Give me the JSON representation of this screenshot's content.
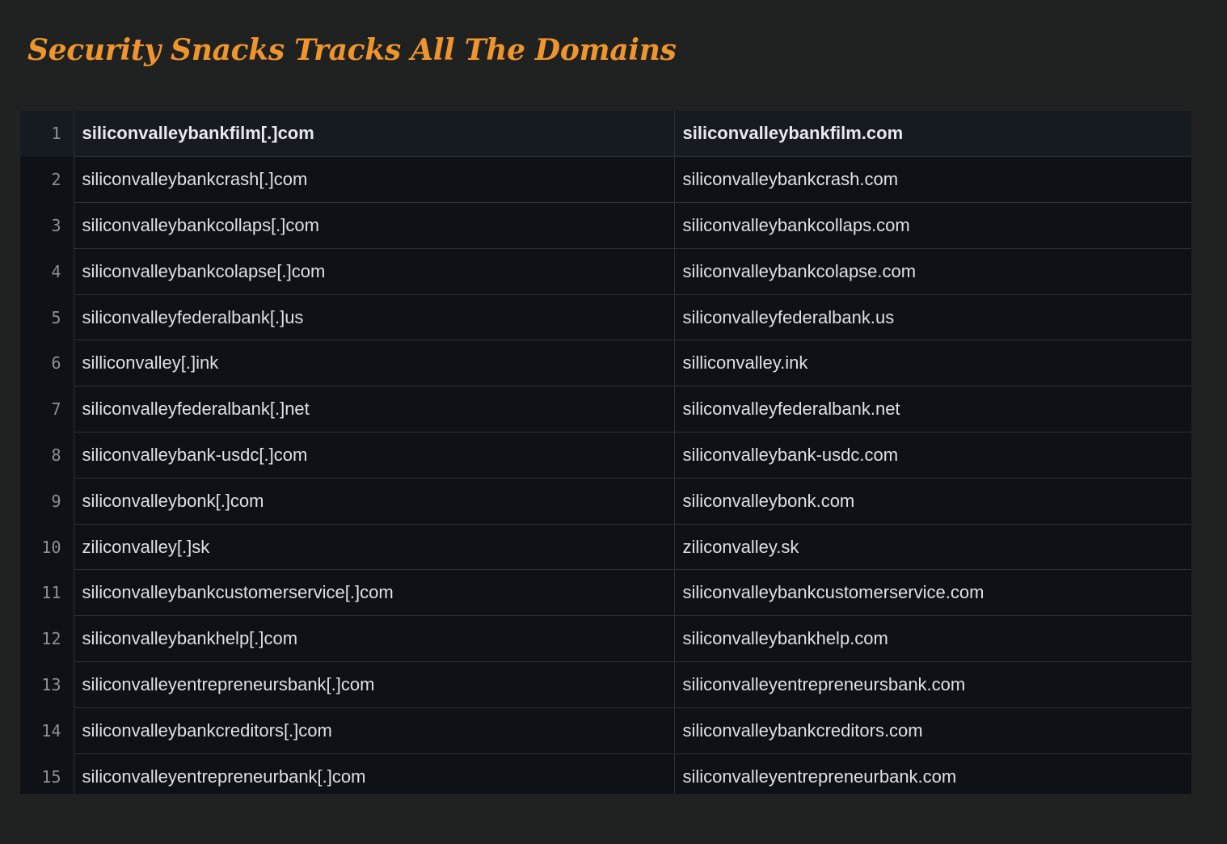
{
  "title": "Security Snacks Tracks All The Domains",
  "colors": {
    "background": "#202221",
    "title": "#f0952d",
    "table_background": "#0e1116",
    "header_row": "#161b22",
    "grid_line": "#2c3038",
    "line_number": "#8c9097",
    "cell_text": "#dde1e6"
  },
  "rows": [
    {
      "num": "1",
      "defanged": "siliconvalleybankfilm[.]com",
      "domain": "siliconvalleybankfilm.com"
    },
    {
      "num": "2",
      "defanged": "siliconvalleybankcrash[.]com",
      "domain": "siliconvalleybankcrash.com"
    },
    {
      "num": "3",
      "defanged": "siliconvalleybankcollaps[.]com",
      "domain": "siliconvalleybankcollaps.com"
    },
    {
      "num": "4",
      "defanged": "siliconvalleybankcolapse[.]com",
      "domain": "siliconvalleybankcolapse.com"
    },
    {
      "num": "5",
      "defanged": "siliconvalleyfederalbank[.]us",
      "domain": "siliconvalleyfederalbank.us"
    },
    {
      "num": "6",
      "defanged": "silliconvalley[.]ink",
      "domain": "silliconvalley.ink"
    },
    {
      "num": "7",
      "defanged": "siliconvalleyfederalbank[.]net",
      "domain": "siliconvalleyfederalbank.net"
    },
    {
      "num": "8",
      "defanged": "siliconvalleybank-usdc[.]com",
      "domain": "siliconvalleybank-usdc.com"
    },
    {
      "num": "9",
      "defanged": "siliconvalleybonk[.]com",
      "domain": "siliconvalleybonk.com"
    },
    {
      "num": "10",
      "defanged": "ziliconvalley[.]sk",
      "domain": "ziliconvalley.sk"
    },
    {
      "num": "11",
      "defanged": "siliconvalleybankcustomerservice[.]com",
      "domain": "siliconvalleybankcustomerservice.com"
    },
    {
      "num": "12",
      "defanged": "siliconvalleybankhelp[.]com",
      "domain": "siliconvalleybankhelp.com"
    },
    {
      "num": "13",
      "defanged": "siliconvalleyentrepreneursbank[.]com",
      "domain": "siliconvalleyentrepreneursbank.com"
    },
    {
      "num": "14",
      "defanged": "siliconvalleybankcreditors[.]com",
      "domain": "siliconvalleybankcreditors.com"
    },
    {
      "num": "15",
      "defanged": "siliconvalleyentrepreneurbank[.]com",
      "domain": "siliconvalleyentrepreneurbank.com"
    }
  ]
}
